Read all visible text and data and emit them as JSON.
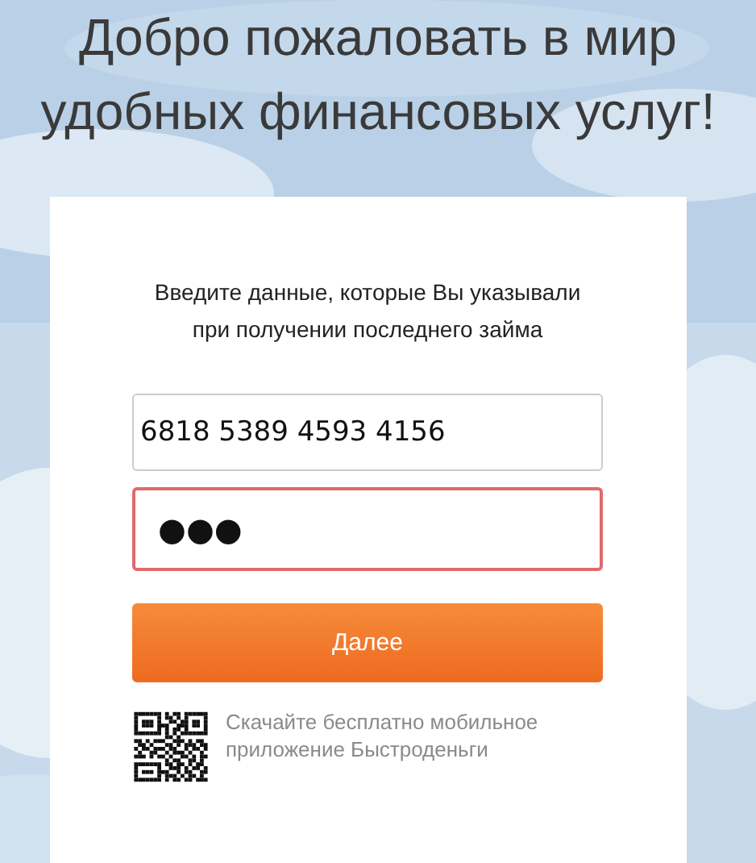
{
  "heading": [
    "Добро пожаловать в мир",
    "удобных финансовых услуг!"
  ],
  "form": {
    "instruction": [
      "Введите данные, которые Вы указывали",
      "при получении последнего займа"
    ],
    "fields": [
      {
        "value": "6818 5389 4593 4156",
        "error": false
      },
      {
        "value": "●●●",
        "error": true
      }
    ],
    "submit": "Далее",
    "app_promo": [
      "Скачайте бесплатно мобильное",
      "приложение Быстроденьги"
    ]
  }
}
